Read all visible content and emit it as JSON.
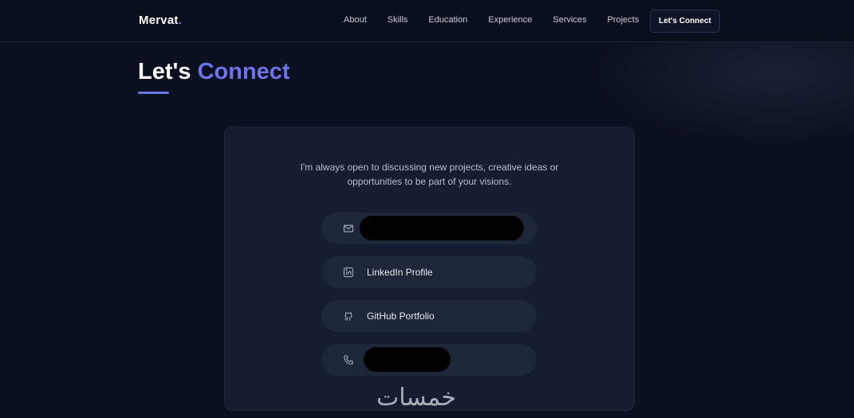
{
  "brand": {
    "name": "Mervat",
    "dot": "."
  },
  "nav": {
    "links": [
      "About",
      "Skills",
      "Education",
      "Experience",
      "Services",
      "Projects"
    ],
    "cta": "Let's Connect"
  },
  "page": {
    "title_part1": "Let's ",
    "title_accent": "Connect"
  },
  "card": {
    "intro_line1": "I'm always open to discussing new projects, creative ideas or",
    "intro_line2": "opportunities to be part of your visions.",
    "contacts": [
      {
        "icon": "mail-icon",
        "label": "",
        "redacted": true
      },
      {
        "icon": "linkedin-icon",
        "label": "LinkedIn Profile",
        "redacted": false
      },
      {
        "icon": "github-icon",
        "label": "GitHub Portfolio",
        "redacted": false
      },
      {
        "icon": "phone-icon",
        "label": "",
        "redacted": true
      }
    ]
  },
  "watermark": {
    "text": "خمسات"
  },
  "colors": {
    "background": "#0b1020",
    "accent": "#6d74e8",
    "card": "#161d30",
    "pill": "#1e2639"
  }
}
